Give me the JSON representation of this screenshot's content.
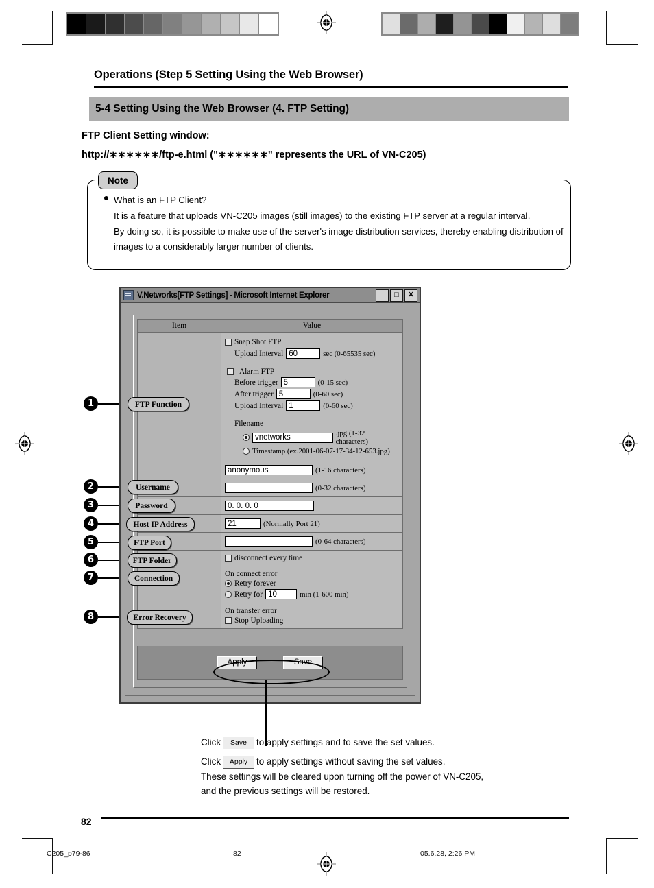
{
  "page": {
    "header_title": "Operations (Step 5 Setting Using the Web Browser)",
    "section_title": "5-4 Setting Using the Web Browser (4. FTP Setting)",
    "sub_line_1": "FTP Client Setting window:",
    "sub_line_2": "http://∗∗∗∗∗∗/ftp-e.html (\"∗∗∗∗∗∗\" represents the URL of VN-C205)",
    "page_number": "82",
    "accent_gray": "#adadad"
  },
  "note": {
    "tab_label": "Note",
    "heading": "What is an FTP Client?",
    "paragraph_1": "It is a feature that uploads VN-C205 images (still images) to the existing FTP server at a regular interval.",
    "paragraph_2": "By doing so, it is possible to make use of the server's image distribution services, thereby enabling distribution of images to a considerably larger number of clients."
  },
  "callouts": [
    {
      "number": "1",
      "label": "FTP Function"
    },
    {
      "number": "2",
      "label": "Username"
    },
    {
      "number": "3",
      "label": "Password"
    },
    {
      "number": "4",
      "label": "Host IP Address"
    },
    {
      "number": "5",
      "label": "FTP Port"
    },
    {
      "number": "6",
      "label": "FTP Folder"
    },
    {
      "number": "7",
      "label": "Connection"
    },
    {
      "number": "8",
      "label": "Error Recovery"
    }
  ],
  "browser": {
    "title": "V.Networks[FTP Settings] - Microsoft Internet Explorer",
    "minimize_label": "_",
    "maximize_label": "□",
    "close_label": "✕",
    "columns": {
      "item": "Item",
      "value": "Value"
    },
    "ftp_function": {
      "snapshot_checkbox_label": "Snap Shot FTP",
      "snapshot_interval_label": "Upload Interval",
      "snapshot_interval_value": "60",
      "snapshot_interval_hint": "sec (0-65535 sec)",
      "alarm_checkbox_label": "Alarm FTP",
      "before_trigger_label": "Before trigger",
      "before_trigger_value": "5",
      "before_trigger_hint": "(0-15 sec)",
      "after_trigger_label": "After   trigger",
      "after_trigger_value": "5",
      "after_trigger_hint": "(0-60 sec)",
      "alarm_interval_label": "Upload Interval",
      "alarm_interval_value": "1",
      "alarm_interval_hint": "(0-60 sec)",
      "filename_label": "Filename",
      "filename_value": "vnetworks",
      "filename_hint": ".jpg (1-32 characters)",
      "timestamp_label": "Timestamp (ex.2001-06-07-17-34-12-653.jpg)"
    },
    "username": {
      "value": "anonymous",
      "hint": "(1-16 characters)"
    },
    "password": {
      "value": "",
      "hint": "(0-32 characters)"
    },
    "host_ip": {
      "value": "0. 0. 0. 0"
    },
    "ftp_port": {
      "value": "21",
      "hint": "(Normally Port 21)"
    },
    "ftp_folder": {
      "value": "",
      "hint": "(0-64 characters)"
    },
    "connection": {
      "checkbox_label": "disconnect every time"
    },
    "error_recovery": {
      "connect_error_label": "On connect error",
      "retry_forever_label": "Retry forever",
      "retry_for_label": "Retry for",
      "retry_for_value": "10",
      "retry_for_hint": "min (1-600 min)",
      "transfer_error_label": "On transfer error",
      "stop_uploading_label": "Stop Uploading"
    },
    "buttons": {
      "apply": "Apply",
      "save": "Save"
    }
  },
  "caption": {
    "line1_pre": "Click",
    "line1_btn": "Save",
    "line1_post": "to apply settings and to save the set values.",
    "line2_pre": "Click",
    "line2_btn": "Apply",
    "line2_post": "to apply settings without saving the set values.",
    "line3": "These settings will be cleared upon turning off the power of VN-C205,",
    "line4": "and the previous settings will be restored."
  },
  "footer": {
    "file": "C205_p79-86",
    "page": "82",
    "date": "05.6.28, 2:26 PM"
  },
  "calibration": {
    "left_bar": [
      "#000000",
      "#1a1a1a",
      "#303030",
      "#4c4c4c",
      "#666666",
      "#808080",
      "#969696",
      "#b0b0b0",
      "#c6c6c6",
      "#e8e8e8",
      "#ffffff"
    ],
    "right_bar": [
      "#e0e0e0",
      "#6b6b6b",
      "#adadad",
      "#1e1e1e",
      "#949494",
      "#4a4a4a",
      "#000000",
      "#f0f0f0",
      "#b4b4b4",
      "#dedede",
      "#7d7d7d"
    ]
  }
}
